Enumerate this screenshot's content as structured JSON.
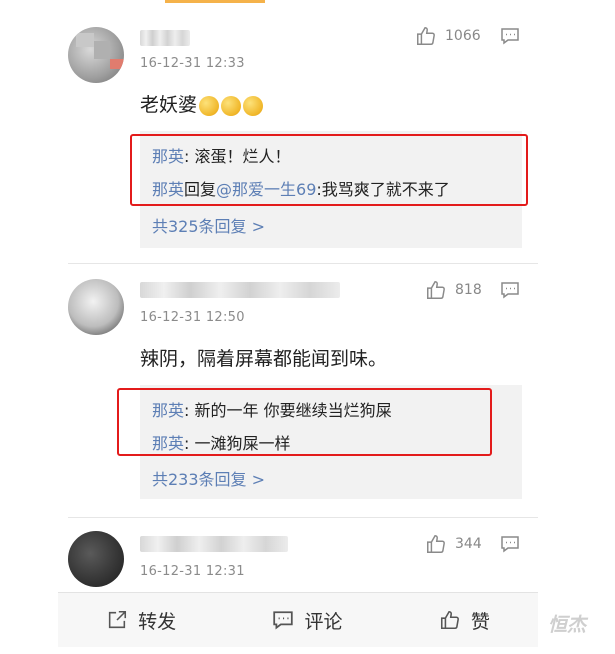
{
  "comments": [
    {
      "timestamp": "16-12-31 12:33",
      "likes": "1066",
      "text": "老妖婆",
      "emoji_count": 3,
      "replies": [
        {
          "author": "那英",
          "sep": ": ",
          "body": "滚蛋！烂人！"
        },
        {
          "author": "那英",
          "mid": "回复",
          "mention": "@那爱一生69",
          "sep": ":",
          "body": "我骂爽了就不来了"
        }
      ],
      "reply_count": "共325条回复 >"
    },
    {
      "timestamp": "16-12-31 12:50",
      "likes": "818",
      "text": "辣阴，隔着屏幕都能闻到味。",
      "replies": [
        {
          "author": "那英",
          "sep": ": ",
          "body": "新的一年 你要继续当烂狗屎"
        },
        {
          "author": "那英",
          "sep": ": ",
          "body": "一滩狗屎一样"
        }
      ],
      "reply_count": "共233条回复 >"
    },
    {
      "timestamp": "16-12-31 12:31",
      "likes": "344"
    }
  ],
  "bottom_bar": {
    "repost_label": "转发",
    "comment_label": "评论",
    "like_label": "赞"
  },
  "watermark": "恒杰",
  "colors": {
    "link_blue": "#5d7fb5",
    "highlight_red": "#e31b1b",
    "accent_orange": "#f5b24a"
  }
}
